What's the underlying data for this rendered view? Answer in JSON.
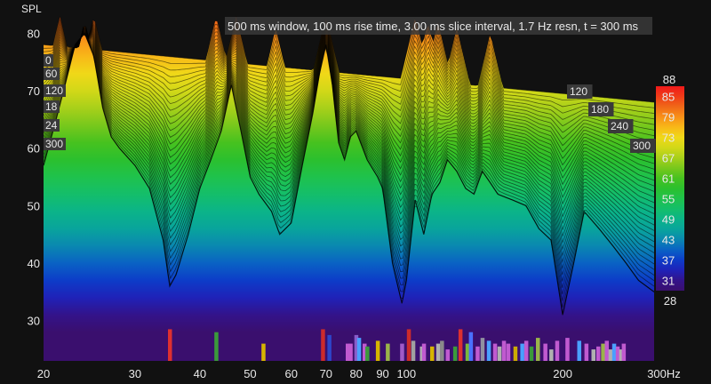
{
  "chart_data": {
    "type": "area",
    "subtype": "waterfall",
    "title": "500 ms window, 100 ms rise time, 3.00 ms slice interval, 1.7 Hz resn, t = 300 ms",
    "ylabel": "SPL",
    "xunit": "Hz",
    "xscale": "log",
    "xlim": [
      20,
      300
    ],
    "ylim": [
      23,
      83
    ],
    "x_ticks": [
      20,
      30,
      40,
      50,
      60,
      70,
      80,
      90,
      100,
      200,
      300
    ],
    "x_tick_labels": [
      "20",
      "30",
      "40",
      "50",
      "60",
      "70",
      "80",
      "90",
      "100",
      "200",
      "300Hz"
    ],
    "y_ticks": [
      30,
      40,
      50,
      60,
      70,
      80
    ],
    "time_labels_left": [
      "0",
      "60",
      "120",
      "18",
      "24",
      "300"
    ],
    "time_labels_right": [
      "120",
      "180",
      "240",
      "300"
    ],
    "colorbar": {
      "min": 28,
      "max": 88,
      "ticks": [
        31,
        37,
        43,
        49,
        55,
        61,
        67,
        73,
        79,
        85
      ],
      "top_label": "88",
      "bottom_label": "28"
    },
    "front_slice": {
      "x": [
        20,
        21,
        22,
        23,
        24,
        25,
        26,
        27,
        28,
        30,
        32,
        34,
        35,
        36,
        38,
        40,
        42,
        44,
        45,
        46,
        48,
        50,
        52,
        55,
        57,
        60,
        63,
        66,
        68,
        70,
        72,
        74,
        76,
        78,
        80,
        84,
        88,
        90,
        94,
        98,
        100,
        104,
        108,
        112,
        116,
        120,
        125,
        130,
        135,
        140,
        145,
        150,
        160,
        170,
        180,
        190,
        200,
        210,
        220,
        235,
        250,
        265,
        280,
        300
      ],
      "y": [
        57,
        64,
        71,
        78,
        80,
        76,
        67,
        62,
        60,
        57,
        53,
        44,
        36,
        38,
        45,
        53,
        58,
        63,
        67,
        71,
        63,
        55,
        52,
        49,
        45,
        47,
        57,
        66,
        73,
        78,
        71,
        61,
        58,
        62,
        63,
        58,
        55,
        53,
        40,
        33,
        37,
        51,
        45,
        52,
        54,
        58,
        56,
        53,
        52,
        56,
        54,
        52,
        51,
        50,
        46,
        44,
        31,
        40,
        49,
        46,
        43,
        40,
        37,
        35
      ]
    },
    "peak_values": {
      "x": [
        21.5,
        24,
        25,
        43,
        47,
        56,
        70,
        104,
        110,
        115,
        125,
        145
      ],
      "y": [
        83,
        82,
        83,
        83,
        83,
        81,
        83,
        83,
        82,
        82,
        81,
        80
      ]
    },
    "bars": {
      "x": [
        35,
        43,
        53,
        69,
        71,
        77,
        78,
        80,
        81,
        83,
        84,
        88,
        92,
        98,
        101,
        103,
        107,
        108,
        112,
        115,
        117,
        120,
        124,
        127,
        131,
        133,
        137,
        140,
        144,
        148,
        151,
        154,
        157,
        162,
        167,
        170,
        174,
        179,
        185,
        190,
        195,
        204,
        215,
        222,
        229,
        234,
        239,
        243,
        247,
        251,
        255,
        259,
        262
      ],
      "y": [
        28.5,
        28.0,
        26.0,
        28.5,
        27.5,
        26.0,
        26.0,
        27.5,
        27.0,
        26.0,
        25.5,
        26.5,
        26.0,
        26.0,
        28.5,
        26.5,
        25.5,
        26.0,
        25.5,
        26.0,
        26.5,
        25.0,
        25.5,
        28.5,
        26.0,
        28.0,
        25.5,
        27.0,
        26.5,
        26.0,
        25.5,
        26.5,
        26.0,
        25.5,
        26.0,
        26.5,
        25.5,
        27.0,
        26.0,
        25.0,
        26.5,
        27.0,
        26.5,
        26.0,
        25.0,
        25.5,
        26.0,
        26.5,
        25.0,
        26.0,
        25.5,
        25.0,
        26.0
      ],
      "colors": [
        "#dd3030",
        "#3b9a3b",
        "#d6b400",
        "#cc2b2b",
        "#2d45c9",
        "#c05ad0",
        "#c05ad0",
        "#8a5cc9",
        "#4aa0ff",
        "#c05ad0",
        "#3b9a3b",
        "#d6b400",
        "#9ab44a",
        "#a05ac8",
        "#cc2b2b",
        "#a0a0a0",
        "#b0b0b0",
        "#c05ad0",
        "#d6b400",
        "#b0b0b0",
        "#8a8a8a",
        "#c05ad0",
        "#3b9a3b",
        "#dd3030",
        "#7ab83a",
        "#4a70ff",
        "#c05ad0",
        "#9090a0",
        "#4aa0ff",
        "#c05ad0",
        "#b0b0b0",
        "#c05ad0",
        "#c05ad0",
        "#ccaa00",
        "#4aa0ff",
        "#c05ad0",
        "#3b9a3b",
        "#9ab44a",
        "#c05ad0",
        "#b0b0b0",
        "#c05ad0",
        "#c05ad0",
        "#4aa0ff",
        "#c05ad0",
        "#b0b0b0",
        "#c05ad0",
        "#9ab44a",
        "#c05ad0",
        "#b0b0b0",
        "#4aa0ff",
        "#c05ad0",
        "#b0b0b0",
        "#c05ad0"
      ]
    },
    "grid": false,
    "colors": {
      "background": "#111111",
      "text": "#e8e8e8",
      "label_box": "#3a3a3a"
    }
  }
}
